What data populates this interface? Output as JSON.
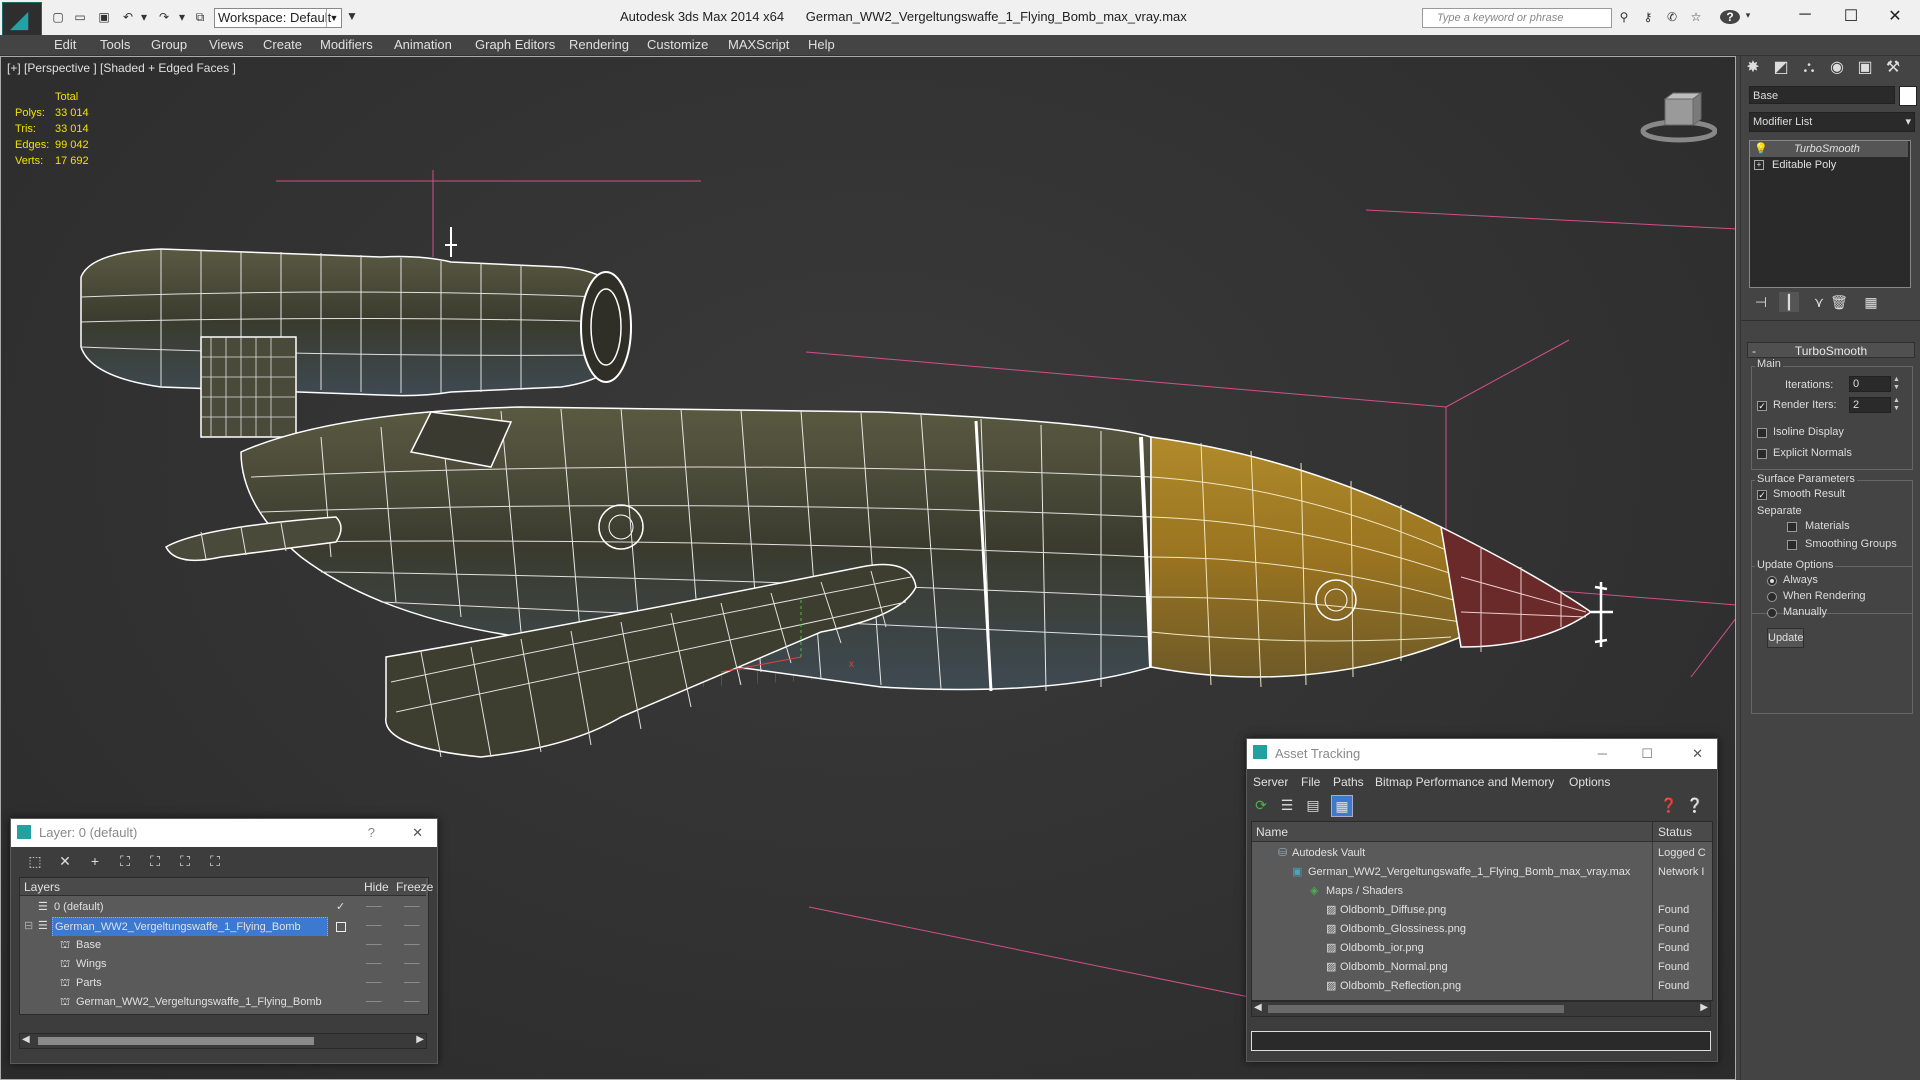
{
  "titlebar": {
    "app_title": "Autodesk 3ds Max  2014 x64",
    "file_title": "German_WW2_Vergeltungswaffe_1_Flying_Bomb_max_vray.max",
    "workspace": "Workspace: Default",
    "search_placeholder": "Type a keyword or phrase",
    "help": "?"
  },
  "menu": [
    "Edit",
    "Tools",
    "Group",
    "Views",
    "Create",
    "Modifiers",
    "Animation",
    "Graph Editors",
    "Rendering",
    "Customize",
    "MAXScript",
    "Help"
  ],
  "viewport": {
    "label": "[+] [Perspective ] [Shaded + Edged Faces ]",
    "stats": {
      "header": "Total",
      "rows": [
        {
          "label": "Polys:",
          "value": "33 014"
        },
        {
          "label": "Tris:",
          "value": "33 014"
        },
        {
          "label": "Edges:",
          "value": "99 042"
        },
        {
          "label": "Verts:",
          "value": "17 692"
        }
      ]
    }
  },
  "command_panel": {
    "object_name": "Base",
    "modifier_list": "Modifier List",
    "stack": [
      "TurboSmooth",
      "Editable Poly"
    ],
    "rollout_title": "TurboSmooth",
    "main": {
      "title": "Main",
      "iterations_label": "Iterations:",
      "iterations": "0",
      "render_iters_label": "Render Iters:",
      "render_iters": "2",
      "isoline": "Isoline Display",
      "explicit": "Explicit Normals"
    },
    "surface": {
      "title": "Surface Parameters",
      "smooth": "Smooth Result",
      "separate": "Separate",
      "materials": "Materials",
      "smoothing_groups": "Smoothing Groups"
    },
    "update": {
      "title": "Update Options",
      "always": "Always",
      "when_rendering": "When Rendering",
      "manually": "Manually",
      "button": "Update"
    }
  },
  "layer_dialog": {
    "title": "Layer: 0 (default)",
    "help": "?",
    "columns": [
      "Layers",
      "Hide",
      "Freeze"
    ],
    "rows": [
      {
        "name": "0 (default)",
        "indent": 0
      },
      {
        "name": "German_WW2_Vergeltungswaffe_1_Flying_Bomb",
        "indent": 0
      },
      {
        "name": "Base",
        "indent": 1
      },
      {
        "name": "Wings",
        "indent": 1
      },
      {
        "name": "Parts",
        "indent": 1
      },
      {
        "name": "German_WW2_Vergeltungswaffe_1_Flying_Bomb",
        "indent": 1
      }
    ]
  },
  "asset_dialog": {
    "title": "Asset Tracking",
    "menu": [
      "Server",
      "File",
      "Paths",
      "Bitmap Performance and Memory",
      "Options"
    ],
    "columns": [
      "Name",
      "Status"
    ],
    "rows": [
      {
        "name": "Autodesk Vault",
        "status": "Logged C",
        "indent": 1
      },
      {
        "name": "German_WW2_Vergeltungswaffe_1_Flying_Bomb_max_vray.max",
        "status": "Network I",
        "indent": 2
      },
      {
        "name": "Maps / Shaders",
        "status": "",
        "indent": 3
      },
      {
        "name": "Oldbomb_Diffuse.png",
        "status": "Found",
        "indent": 4
      },
      {
        "name": "Oldbomb_Glossiness.png",
        "status": "Found",
        "indent": 4
      },
      {
        "name": "Oldbomb_ior.png",
        "status": "Found",
        "indent": 4
      },
      {
        "name": "Oldbomb_Normal.png",
        "status": "Found",
        "indent": 4
      },
      {
        "name": "Oldbomb_Reflection.png",
        "status": "Found",
        "indent": 4
      }
    ]
  },
  "colors": {
    "accent": "#1e9a9a",
    "selection": "#3b7ad0",
    "stats": "#f0e000",
    "bbox": "#d0508a"
  }
}
